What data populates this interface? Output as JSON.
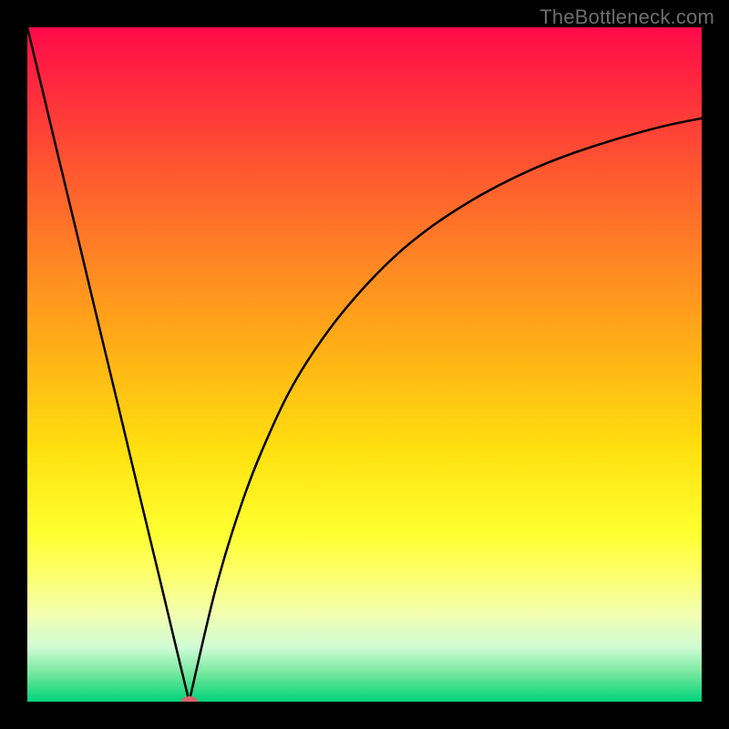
{
  "attribution": "TheBottleneck.com",
  "gradient": {
    "stops": [
      {
        "pos": 0.0,
        "color": "#ff0a4a"
      },
      {
        "pos": 0.1,
        "color": "#ff2e3c"
      },
      {
        "pos": 0.22,
        "color": "#ff5a2f"
      },
      {
        "pos": 0.36,
        "color": "#ff8a22"
      },
      {
        "pos": 0.5,
        "color": "#ffb714"
      },
      {
        "pos": 0.63,
        "color": "#ffe110"
      },
      {
        "pos": 0.75,
        "color": "#ffff30"
      },
      {
        "pos": 0.81,
        "color": "#fdff6a"
      },
      {
        "pos": 0.87,
        "color": "#f2ffb0"
      },
      {
        "pos": 0.92,
        "color": "#cffbd5"
      },
      {
        "pos": 0.96,
        "color": "#6fe79c"
      },
      {
        "pos": 1.0,
        "color": "#00d27a"
      }
    ]
  },
  "chart_data": {
    "type": "line",
    "title": "",
    "xlabel": "",
    "ylabel": "",
    "xlim": [
      0,
      100
    ],
    "ylim": [
      0,
      100
    ],
    "x_at_minimum": 24,
    "marker": {
      "x": 24,
      "y": 0,
      "color": "#d9636a"
    },
    "series": [
      {
        "name": "left-branch",
        "x": [
          0,
          2,
          4,
          6,
          8,
          10,
          12,
          14,
          16,
          18,
          20,
          22,
          24
        ],
        "y": [
          100,
          91.7,
          83.3,
          75,
          66.7,
          58.3,
          50,
          41.7,
          33.3,
          25,
          16.7,
          8.3,
          0
        ]
      },
      {
        "name": "right-branch",
        "x": [
          24,
          28,
          32,
          36,
          40,
          45,
          50,
          55,
          60,
          65,
          70,
          75,
          80,
          85,
          90,
          95,
          100
        ],
        "y": [
          0,
          17,
          30,
          40,
          48,
          55.5,
          61.5,
          66.5,
          70.5,
          73.8,
          76.6,
          79,
          81,
          82.7,
          84.2,
          85.5,
          86.5
        ]
      }
    ]
  }
}
